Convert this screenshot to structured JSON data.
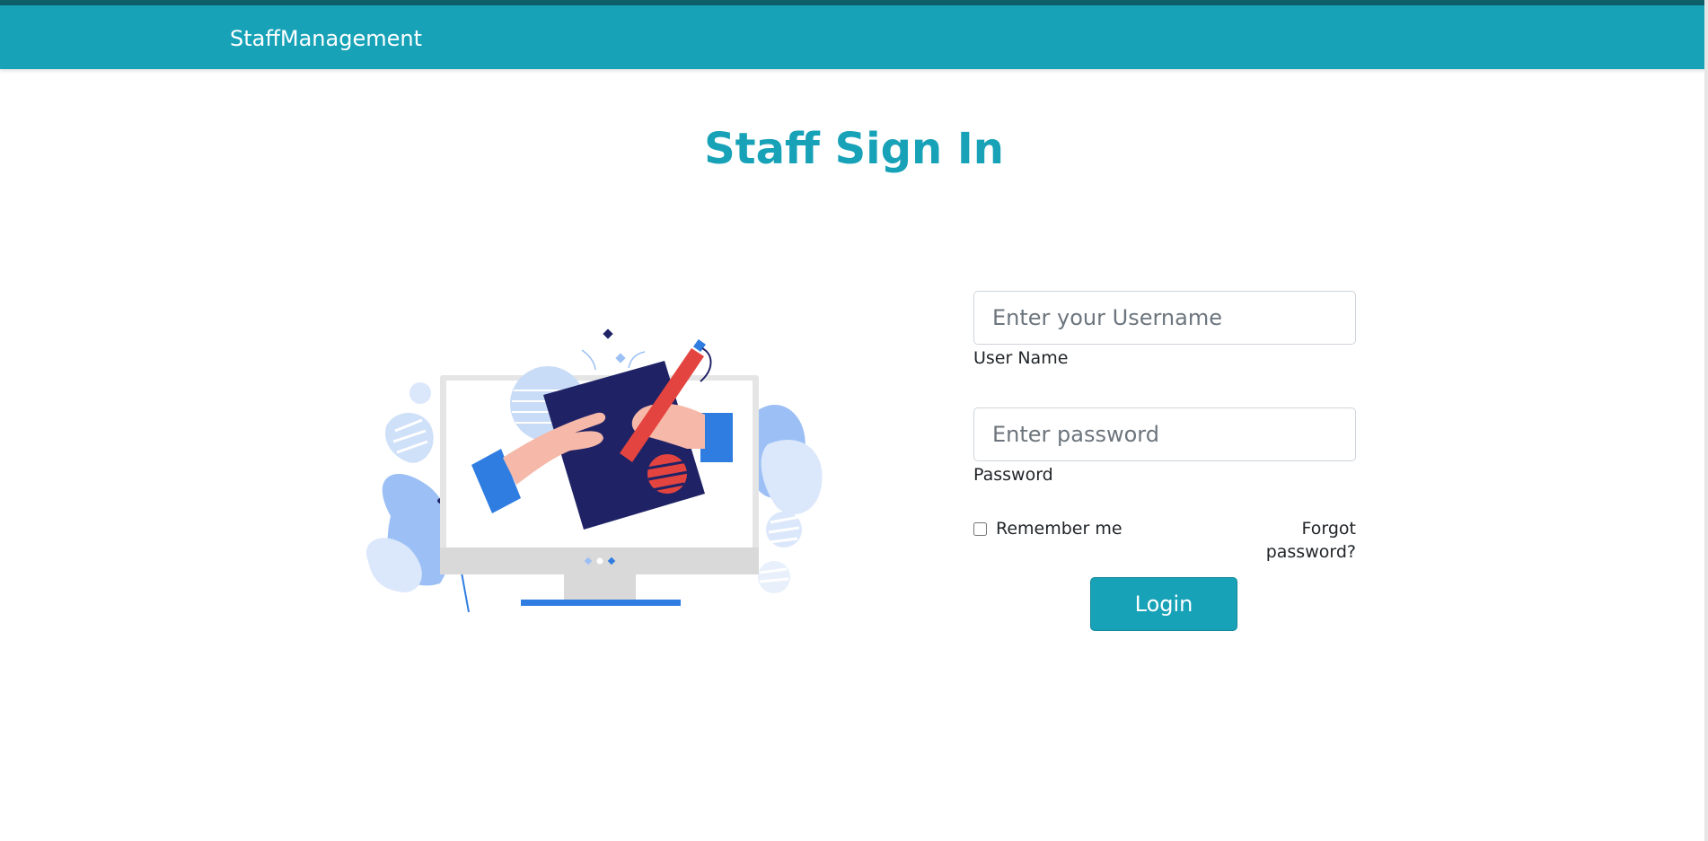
{
  "navbar": {
    "brand": "StaffManagement",
    "color": "#17a2b8"
  },
  "page": {
    "title": "Staff Sign In"
  },
  "form": {
    "username": {
      "placeholder": "Enter your Username",
      "value": "",
      "label": "User Name"
    },
    "password": {
      "placeholder": "Enter password",
      "value": "",
      "label": "Password"
    },
    "remember_label": "Remember me",
    "remember_checked": false,
    "forgot_label": "Forgot password?",
    "login_label": "Login"
  },
  "illustration": {
    "icon": "computer-signing-illustration",
    "colors": {
      "navy": "#1f2366",
      "blue": "#2f7de1",
      "light_blue": "#9cc0f5",
      "red": "#e4443f",
      "skin": "#f6b8a8"
    }
  }
}
